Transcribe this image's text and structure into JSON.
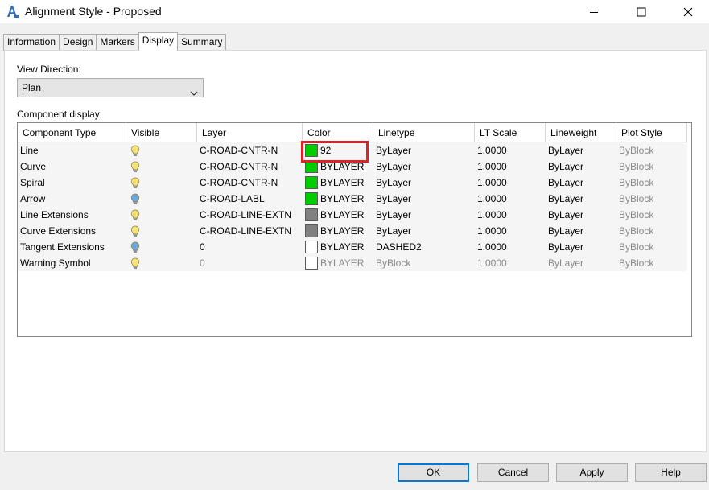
{
  "window": {
    "title": "Alignment Style - Proposed",
    "app_icon": "autocad-civil-a-icon"
  },
  "tabs": [
    {
      "label": "Information",
      "active": false
    },
    {
      "label": "Design",
      "active": false
    },
    {
      "label": "Markers",
      "active": false
    },
    {
      "label": "Display",
      "active": true
    },
    {
      "label": "Summary",
      "active": false
    }
  ],
  "view_direction": {
    "label": "View Direction:",
    "value": "Plan"
  },
  "component_display": {
    "label": "Component display:",
    "columns": [
      "Component Type",
      "Visible",
      "Layer",
      "Color",
      "Linetype",
      "LT Scale",
      "Lineweight",
      "Plot Style"
    ],
    "rows": [
      {
        "type": "Line",
        "visible": "on",
        "layer": "C-ROAD-CNTR-N",
        "color_swatch": "#00cc00",
        "color": "92",
        "linetype": "ByLayer",
        "lt_scale": "1.0000",
        "lineweight": "ByLayer",
        "plot_style": "ByBlock",
        "dim": false
      },
      {
        "type": "Curve",
        "visible": "on",
        "layer": "C-ROAD-CNTR-N",
        "color_swatch": "#00cc00",
        "color": "BYLAYER",
        "linetype": "ByLayer",
        "lt_scale": "1.0000",
        "lineweight": "ByLayer",
        "plot_style": "ByBlock",
        "dim": false
      },
      {
        "type": "Spiral",
        "visible": "on",
        "layer": "C-ROAD-CNTR-N",
        "color_swatch": "#00cc00",
        "color": "BYLAYER",
        "linetype": "ByLayer",
        "lt_scale": "1.0000",
        "lineweight": "ByLayer",
        "plot_style": "ByBlock",
        "dim": false
      },
      {
        "type": "Arrow",
        "visible": "off",
        "layer": "C-ROAD-LABL",
        "color_swatch": "#00cc00",
        "color": "BYLAYER",
        "linetype": "ByLayer",
        "lt_scale": "1.0000",
        "lineweight": "ByLayer",
        "plot_style": "ByBlock",
        "dim": false
      },
      {
        "type": "Line Extensions",
        "visible": "on",
        "layer": "C-ROAD-LINE-EXTN",
        "color_swatch": "#808080",
        "color": "BYLAYER",
        "linetype": "ByLayer",
        "lt_scale": "1.0000",
        "lineweight": "ByLayer",
        "plot_style": "ByBlock",
        "dim": false
      },
      {
        "type": "Curve Extensions",
        "visible": "on",
        "layer": "C-ROAD-LINE-EXTN",
        "color_swatch": "#808080",
        "color": "BYLAYER",
        "linetype": "ByLayer",
        "lt_scale": "1.0000",
        "lineweight": "ByLayer",
        "plot_style": "ByBlock",
        "dim": false
      },
      {
        "type": "Tangent Extensions",
        "visible": "off",
        "layer": "0",
        "color_swatch": "#ffffff",
        "color": "BYLAYER",
        "linetype": "DASHED2",
        "lt_scale": "1.0000",
        "lineweight": "ByLayer",
        "plot_style": "ByBlock",
        "dim": false
      },
      {
        "type": "Warning Symbol",
        "visible": "on",
        "layer": "0",
        "color_swatch": "#ffffff",
        "color": "BYLAYER",
        "linetype": "ByBlock",
        "lt_scale": "1.0000",
        "lineweight": "ByLayer",
        "plot_style": "ByBlock",
        "dim": true
      }
    ]
  },
  "buttons": {
    "ok": "OK",
    "cancel": "Cancel",
    "apply": "Apply",
    "help": "Help"
  },
  "colors": {
    "highlight": "#d8232a",
    "bulb_on": "#f5e27a",
    "bulb_off": "#6fa8dc"
  }
}
